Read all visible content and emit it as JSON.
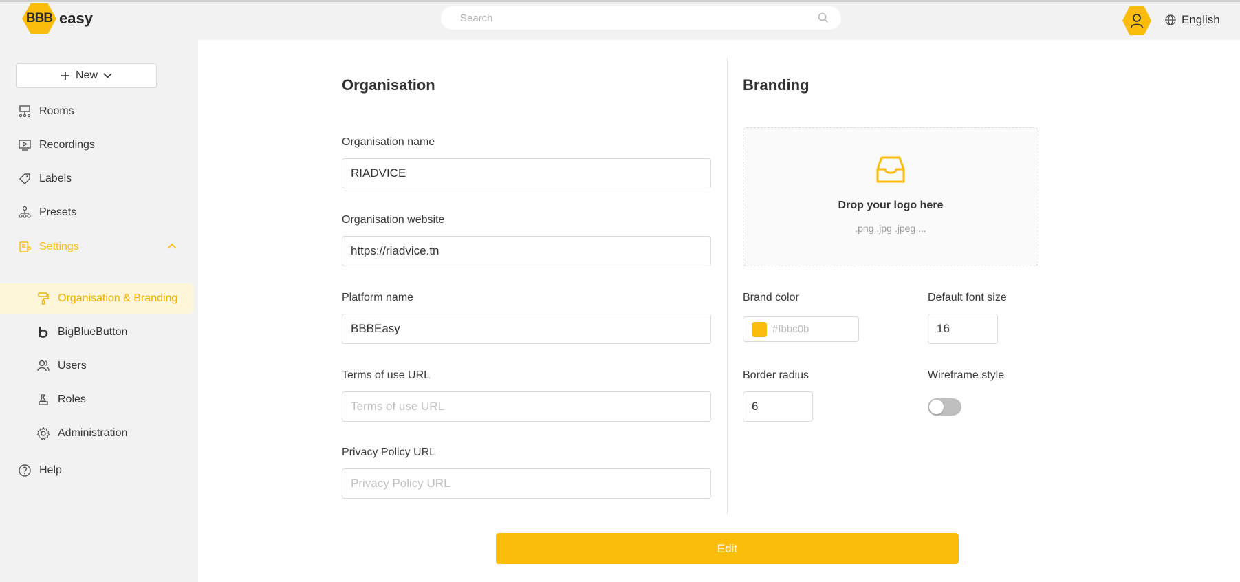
{
  "header": {
    "logo_hex": "BBB",
    "logo_text": "easy",
    "search_placeholder": "Search",
    "language": "English"
  },
  "sidebar": {
    "new_label": "New",
    "items": [
      {
        "label": "Rooms",
        "icon": "presentation-icon"
      },
      {
        "label": "Recordings",
        "icon": "video-screen-icon"
      },
      {
        "label": "Labels",
        "icon": "tag-icon"
      },
      {
        "label": "Presets",
        "icon": "network-icon"
      },
      {
        "label": "Settings",
        "icon": "settings-icon"
      }
    ],
    "settings_children": [
      {
        "label": "Organisation & Branding",
        "icon": "paint-roller-icon"
      },
      {
        "label": "BigBlueButton",
        "icon": "b-logo-icon"
      },
      {
        "label": "Users",
        "icon": "users-icon"
      },
      {
        "label": "Roles",
        "icon": "chess-icon"
      },
      {
        "label": "Administration",
        "icon": "gear-icon"
      }
    ],
    "help": {
      "label": "Help",
      "icon": "question-icon"
    }
  },
  "organisation": {
    "title": "Organisation",
    "name_label": "Organisation name",
    "name_value": "RIADVICE",
    "website_label": "Organisation website",
    "website_value": "https://riadvice.tn",
    "platform_label": "Platform name",
    "platform_value": "BBBEasy",
    "terms_label": "Terms of use URL",
    "terms_placeholder": "Terms of use URL",
    "privacy_label": "Privacy Policy URL",
    "privacy_placeholder": "Privacy Policy URL"
  },
  "branding": {
    "title": "Branding",
    "drop_title": "Drop your logo here",
    "drop_hint": ".png .jpg .jpeg ...",
    "brand_color_label": "Brand color",
    "brand_color_value": "#fbbc0b",
    "font_size_label": "Default font size",
    "font_size_value": "16",
    "border_radius_label": "Border radius",
    "border_radius_value": "6",
    "wireframe_label": "Wireframe style",
    "wireframe_on": false
  },
  "actions": {
    "edit_label": "Edit"
  },
  "colors": {
    "accent": "#fbbc0b",
    "active_bg": "#fef6d9"
  }
}
